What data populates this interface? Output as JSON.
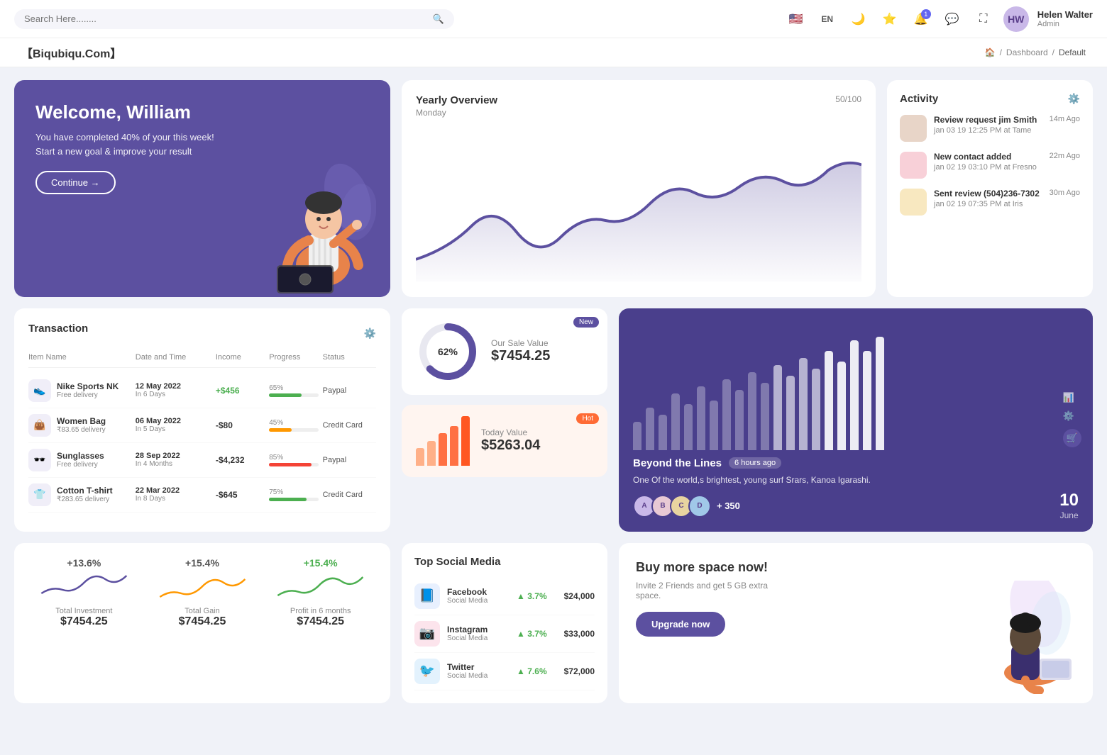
{
  "topnav": {
    "search_placeholder": "Search Here........",
    "lang": "EN",
    "user": {
      "name": "Helen Walter",
      "role": "Admin",
      "initials": "HW"
    },
    "bell_badge": "1"
  },
  "breadcrumb": {
    "brand": "【Biqubiqu.Com】",
    "home": "🏠",
    "separator": "/",
    "dashboard": "Dashboard",
    "current": "Default"
  },
  "welcome": {
    "title": "Welcome, William",
    "desc": "You have completed 40% of your this week! Start a new goal & improve your result",
    "btn": "Continue →"
  },
  "yearly": {
    "title": "Yearly Overview",
    "subtitle": "Monday",
    "count": "50/100"
  },
  "activity": {
    "title": "Activity",
    "items": [
      {
        "title": "Review request jim Smith",
        "sub": "jan 03 19 12:25 PM at Tame",
        "time": "14m Ago"
      },
      {
        "title": "New contact added",
        "sub": "jan 02 19 03:10 PM at Fresno",
        "time": "22m Ago"
      },
      {
        "title": "Sent review (504)236-7302",
        "sub": "jan 02 19 07:35 PM at Iris",
        "time": "30m Ago"
      }
    ]
  },
  "transaction": {
    "title": "Transaction",
    "headers": [
      "Item Name",
      "Date and Time",
      "Income",
      "Progress",
      "Status"
    ],
    "rows": [
      {
        "icon": "👟",
        "name": "Nike Sports NK",
        "sub": "Free delivery",
        "date": "12 May 2022",
        "date_sub": "In 6 Days",
        "income": "+$456",
        "income_type": "pos",
        "progress": 65,
        "progress_color": "#4caf50",
        "status": "Paypal"
      },
      {
        "icon": "👜",
        "name": "Women Bag",
        "sub": "₹83.65 delivery",
        "date": "06 May 2022",
        "date_sub": "In 5 Days",
        "income": "-$80",
        "income_type": "neg",
        "progress": 45,
        "progress_color": "#ff9800",
        "status": "Credit Card"
      },
      {
        "icon": "🕶️",
        "name": "Sunglasses",
        "sub": "Free delivery",
        "date": "28 Sep 2022",
        "date_sub": "In 4 Months",
        "income": "-$4,232",
        "income_type": "neg",
        "progress": 85,
        "progress_color": "#f44336",
        "status": "Paypal"
      },
      {
        "icon": "👕",
        "name": "Cotton T-shirt",
        "sub": "₹283.65 delivery",
        "date": "22 Mar 2022",
        "date_sub": "In 8 Days",
        "income": "-$645",
        "income_type": "neg",
        "progress": 75,
        "progress_color": "#4caf50",
        "status": "Credit Card"
      }
    ]
  },
  "sale_value": {
    "badge": "New",
    "label": "Our Sale Value",
    "amount": "$7454.25",
    "percent": 62
  },
  "today_value": {
    "badge": "Hot",
    "label": "Today Value",
    "amount": "$5263.04"
  },
  "beyond": {
    "title": "Beyond the Lines",
    "time_ago": "6 hours ago",
    "desc": "One Of the world,s brightest, young surf Srars, Kanoa Igarashi.",
    "plus_count": "+ 350",
    "date_num": "10",
    "date_mon": "June"
  },
  "metrics": [
    {
      "pct": "+13.6%",
      "label": "Total Investment",
      "value": "$7454.25",
      "color": "#5c50a0"
    },
    {
      "pct": "+15.4%",
      "label": "Total Gain",
      "value": "$7454.25",
      "color": "#ff9800"
    },
    {
      "pct": "+15.4%",
      "label": "Profit in 6 months",
      "value": "$7454.25",
      "color": "#4caf50"
    }
  ],
  "social": {
    "title": "Top Social Media",
    "items": [
      {
        "icon": "📘",
        "name": "Facebook",
        "sub": "Social Media",
        "pct": "3.7%",
        "amount": "$24,000",
        "icon_bg": "#e8f0fe"
      },
      {
        "icon": "📷",
        "name": "Instagram",
        "sub": "Social Media",
        "pct": "3.7%",
        "amount": "$33,000",
        "icon_bg": "#fce4ec"
      },
      {
        "icon": "🐦",
        "name": "Twitter",
        "sub": "Social Media",
        "pct": "7.6%",
        "amount": "$72,000",
        "icon_bg": "#e3f2fd"
      }
    ]
  },
  "promo": {
    "title": "Buy more space now!",
    "desc": "Invite 2 Friends and get 5 GB extra space.",
    "btn": "Upgrade now"
  },
  "bar_chart": {
    "bars": [
      3,
      5,
      4,
      7,
      6,
      8,
      5,
      9,
      7,
      10,
      8,
      11,
      9,
      12,
      10,
      13,
      11,
      14,
      12,
      15
    ]
  }
}
